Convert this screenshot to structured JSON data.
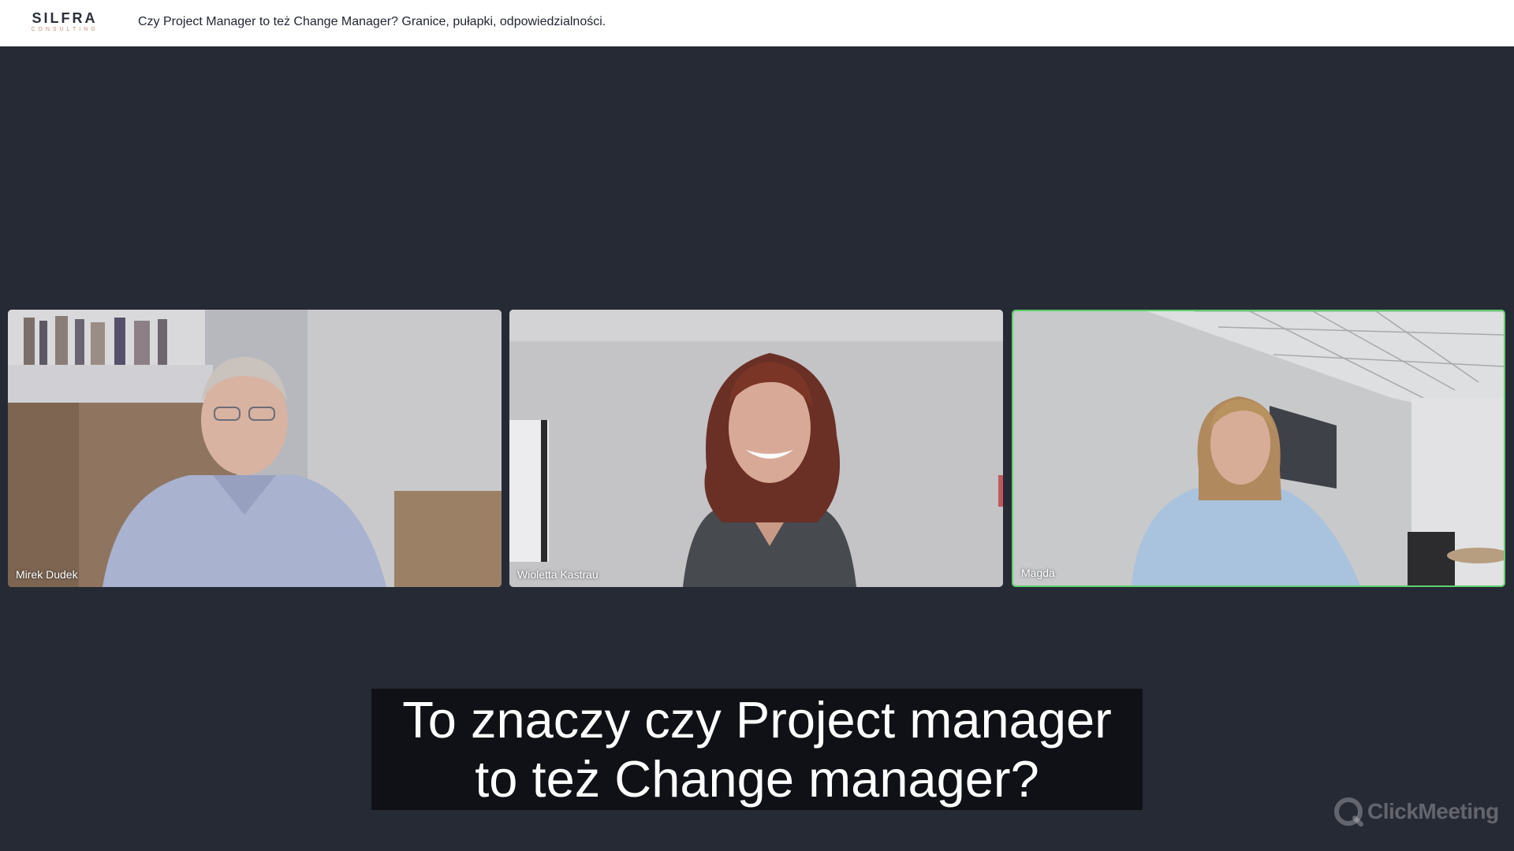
{
  "header": {
    "logo_main": "SILFRA",
    "logo_sub": "CONSULTING",
    "title": "Czy Project Manager to też Change Manager? Granice, pułapki, odpowiedzialności."
  },
  "participants": [
    {
      "name": "Mirek Dudek",
      "active_speaker": false
    },
    {
      "name": "Wioletta Kastrau",
      "active_speaker": false
    },
    {
      "name": "Magda",
      "active_speaker": true
    }
  ],
  "subtitle": {
    "line1": "To znaczy czy Project manager",
    "line2": "to też Change manager?"
  },
  "watermark": {
    "text": "ClickMeeting",
    "icon": "clickmeeting-logo-icon"
  },
  "colors": {
    "background": "#262a35",
    "active_speaker_border": "#5fd16a",
    "caption_background": "#0f1116"
  }
}
